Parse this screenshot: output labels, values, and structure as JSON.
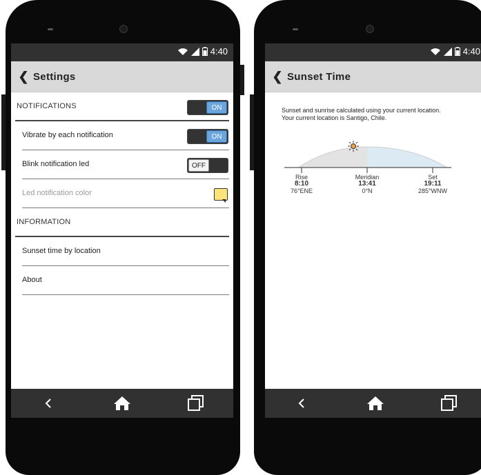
{
  "status": {
    "time": "4:40"
  },
  "settings_screen": {
    "title": "Settings",
    "notifications_header": "NOTIFICATIONS",
    "notifications_toggle": "ON",
    "rows": [
      {
        "label": "Vibrate by each notification",
        "toggle": "ON"
      },
      {
        "label": "Blink notification led",
        "toggle": "OFF"
      },
      {
        "label": "Led notification color"
      }
    ],
    "information_header": "INFORMATION",
    "info_rows": [
      {
        "label": "Sunset time by location"
      },
      {
        "label": "About"
      }
    ]
  },
  "sunset_screen": {
    "title": "Sunset Time",
    "description": "Sunset and sunrise calculated using your current location. Your current location is Santigo, Chile.",
    "rise": {
      "name": "Rise",
      "time": "8:10",
      "dir": "76°ENE"
    },
    "meridian": {
      "name": "Meridian",
      "time": "13:41",
      "dir": "0°N"
    },
    "set": {
      "name": "Set",
      "time": "19:11",
      "dir": "285°WNW"
    }
  },
  "icons": [
    "back-icon",
    "wifi-icon",
    "signal-icon",
    "battery-icon",
    "home-icon",
    "recents-icon",
    "sun-icon",
    "color-swatch-icon"
  ],
  "colors": {
    "toggle_on": "#6aa6dd",
    "swatch": "#fde47a",
    "bar": "#313131",
    "day_arc": "#dbeaf3",
    "night_arc": "#e3e3e3"
  }
}
